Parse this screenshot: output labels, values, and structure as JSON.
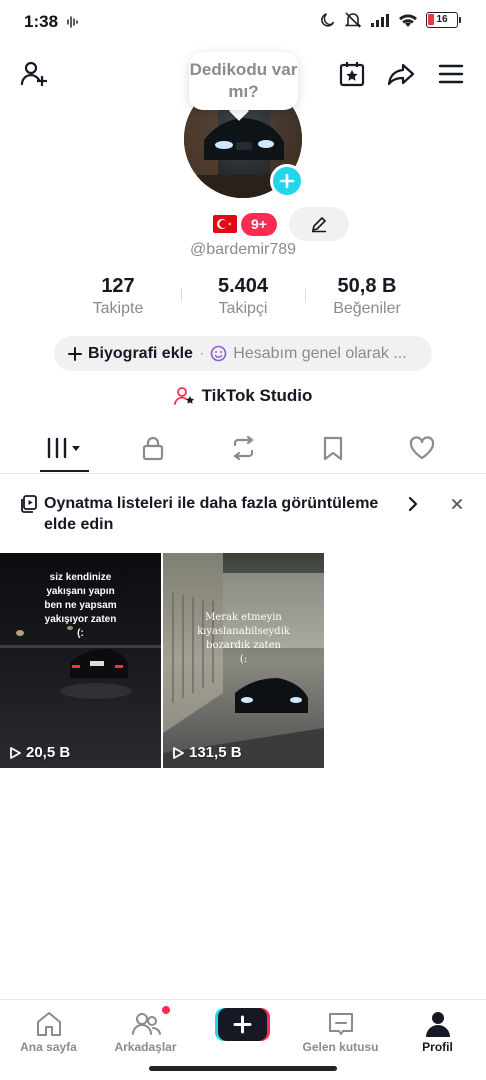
{
  "status_bar": {
    "time": "1:38",
    "battery": "16"
  },
  "header": {
    "bubble_text": "Dedikodu var mı?"
  },
  "profile": {
    "notif_count": "9+",
    "username": "@bardemir789"
  },
  "stats": [
    {
      "value": "127",
      "label": "Takipte"
    },
    {
      "value": "5.404",
      "label": "Takipçi"
    },
    {
      "value": "50,8 B",
      "label": "Beğeniler"
    }
  ],
  "bio": {
    "add_label": "Biyografi ekle",
    "separator": "·",
    "privacy_text": "Hesabım genel olarak ..."
  },
  "studio": {
    "label": "TikTok Studio"
  },
  "banner": {
    "text": "Oynatma listeleri ile daha fazla görüntüleme elde edin"
  },
  "videos": [
    {
      "views": "20,5 B",
      "caption": "siz kendinize\nyakışanı yapın\nben ne yapsam\nyakışıyor zaten\n(:"
    },
    {
      "views": "131,5 B",
      "caption": "Merak etmeyin\nkıyaslanabilseydik\nbozardık zaten\n(:"
    }
  ],
  "bottom_nav": [
    {
      "label": "Ana sayfa"
    },
    {
      "label": "Arkadaşlar"
    },
    {
      "label": ""
    },
    {
      "label": "Gelen kutusu"
    },
    {
      "label": "Profil"
    }
  ],
  "colors": {
    "accent": "#fe2c55",
    "cyan": "#20d5ec",
    "text": "#161823",
    "muted": "#8a8b91"
  }
}
